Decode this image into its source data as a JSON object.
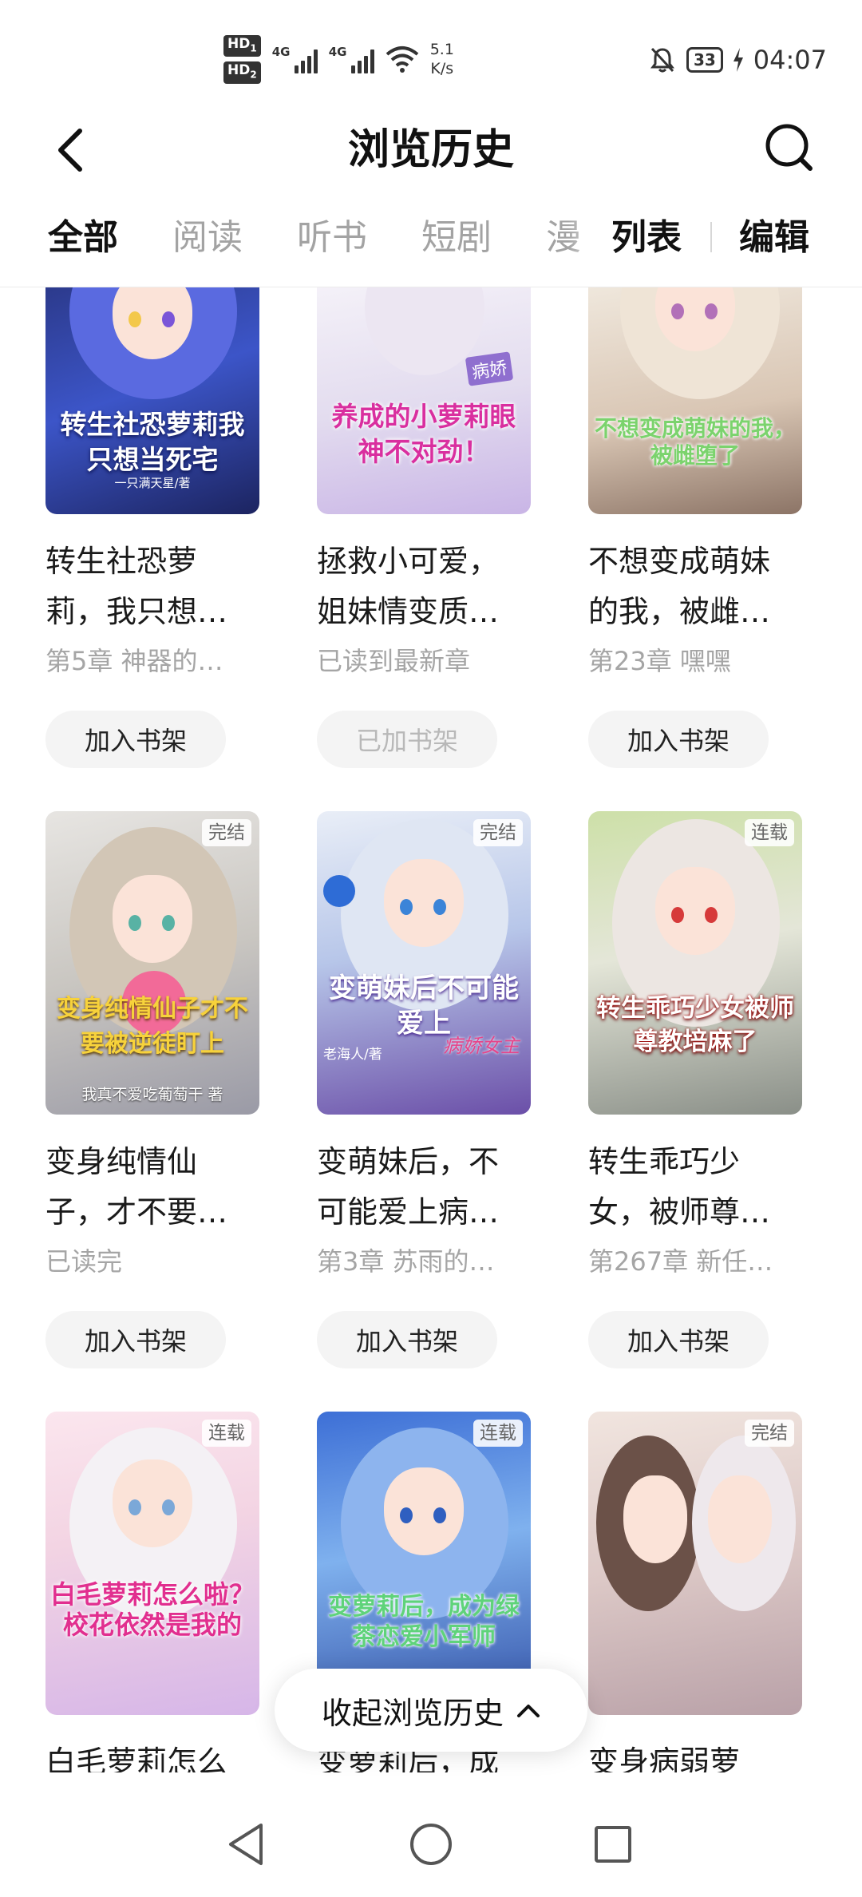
{
  "status_bar": {
    "hd1": "HD",
    "hd1_sub": "1",
    "hd2": "HD",
    "hd2_sub": "2",
    "net1": "4G",
    "net2": "4G",
    "speed_value": "5.1",
    "speed_unit": "K/s",
    "battery": "33",
    "time": "04:07"
  },
  "header": {
    "title": "浏览历史"
  },
  "tabs": {
    "items": [
      "全部",
      "阅读",
      "听书",
      "短剧",
      "漫"
    ],
    "active_index": 0,
    "list_label": "列表",
    "edit_label": "编辑"
  },
  "books": [
    {
      "cover_title": "转生社恐萝莉我只想当死宅",
      "cover_author": "一只满天星/著",
      "title": "转生社恐萝莉，我只想…",
      "progress": "第5章 神器的…",
      "shelf_label": "加入书架",
      "added": false,
      "badge": ""
    },
    {
      "cover_title": "养成的小萝莉眼神不对劲！",
      "cover_author": "",
      "cover_tag": "病娇",
      "title": "拯救小可爱，姐妹情变质…",
      "progress": "已读到最新章",
      "shelf_label": "已加书架",
      "added": true,
      "badge": ""
    },
    {
      "cover_title": "不想变成萌妹的我，被雌堕了",
      "cover_author": "",
      "title": "不想变成萌妹的我，被雌…",
      "progress": "第23章 嘿嘿",
      "shelf_label": "加入书架",
      "added": false,
      "badge": ""
    },
    {
      "cover_title": "变身纯情仙子才不要被逆徒盯上",
      "cover_author": "我真不爱吃葡萄干 著",
      "title": "变身纯情仙子，才不要…",
      "progress": "已读完",
      "shelf_label": "加入书架",
      "added": false,
      "badge": "完结"
    },
    {
      "cover_title": "变萌妹后不可能爱上",
      "cover_author": "老海人/著",
      "cover_tag": "病娇女主",
      "title": "变萌妹后，不可能爱上病…",
      "progress": "第3章 苏雨的…",
      "shelf_label": "加入书架",
      "added": false,
      "badge": "完结"
    },
    {
      "cover_title": "转生乖巧少女被师尊教培麻了",
      "cover_author": "",
      "title": "转生乖巧少女，被师尊…",
      "progress": "第267章 新任…",
      "shelf_label": "加入书架",
      "added": false,
      "badge": "连载"
    },
    {
      "cover_title": "白毛萝莉怎么啦？校花依然是我的",
      "cover_author": "",
      "title": "白毛萝莉怎么",
      "progress": "",
      "shelf_label": "",
      "added": false,
      "badge": "连载"
    },
    {
      "cover_title": "变萝莉后，成为绿茶恋爱小军师",
      "cover_author": "",
      "title": "变萝莉后，成",
      "progress": "",
      "shelf_label": "",
      "added": false,
      "badge": "连载"
    },
    {
      "cover_title": "",
      "cover_author": "",
      "title": "变身病弱萝",
      "progress": "",
      "shelf_label": "",
      "added": false,
      "badge": "完结"
    }
  ],
  "collapse": {
    "label": "收起浏览历史"
  },
  "colors": {
    "accent_text": "#111111",
    "muted_text": "#a5a5a5",
    "button_bg": "#f4f4f4"
  }
}
